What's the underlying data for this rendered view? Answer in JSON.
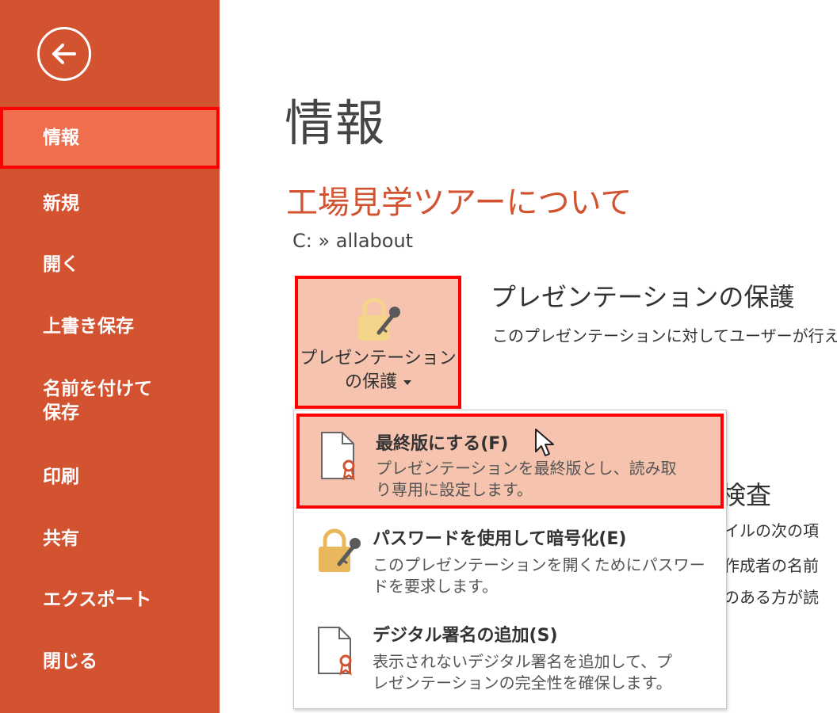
{
  "sidebar": {
    "back_icon": "back-arrow-icon",
    "items": [
      {
        "label": "情報",
        "active": true
      },
      {
        "label": "新規"
      },
      {
        "label": "開く"
      },
      {
        "label": "上書き保存"
      },
      {
        "label_line1": "名前を付けて",
        "label_line2": "保存"
      },
      {
        "label": "印刷"
      },
      {
        "label": "共有"
      },
      {
        "label": "エクスポート"
      },
      {
        "label": "閉じる"
      }
    ]
  },
  "main": {
    "page_title": "情報",
    "doc_title": "工場見学ツアーについて",
    "doc_path": "C: » allabout",
    "protect_button": {
      "line1": "プレゼンテーション",
      "line2": "の保護",
      "icon": "lock-key-icon"
    },
    "protect_section": {
      "heading": "プレゼンテーションの保護",
      "desc": "このプレゼンテーションに対してユーザーが行え"
    },
    "inspect_section": {
      "heading": "検査",
      "lines": [
        "イルの次の項",
        "作成者の名前",
        "のある方が読"
      ]
    }
  },
  "dropdown": {
    "items": [
      {
        "title": "最終版にする(F)",
        "desc_line1": "プレゼンテーションを最終版とし、読み取",
        "desc_line2": "り専用に設定します。",
        "icon": "document-ribbon-icon"
      },
      {
        "title": "パスワードを使用して暗号化(E)",
        "desc_line1": "このプレゼンテーションを開くためにパスワー",
        "desc_line2": "ドを要求します。",
        "icon": "lock-key-icon"
      },
      {
        "title": "デジタル署名の追加(S)",
        "desc_line1": "表示されないデジタル署名を追加して、プ",
        "desc_line2": "レゼンテーションの完全性を確保します。",
        "icon": "document-ribbon-icon"
      }
    ]
  },
  "colors": {
    "sidebar_bg": "#d35230",
    "active_item_bg": "#ee6e4d",
    "highlight_border": "#ff0000",
    "highlight_bg": "#f6c3ae",
    "doc_title": "#d35230"
  }
}
